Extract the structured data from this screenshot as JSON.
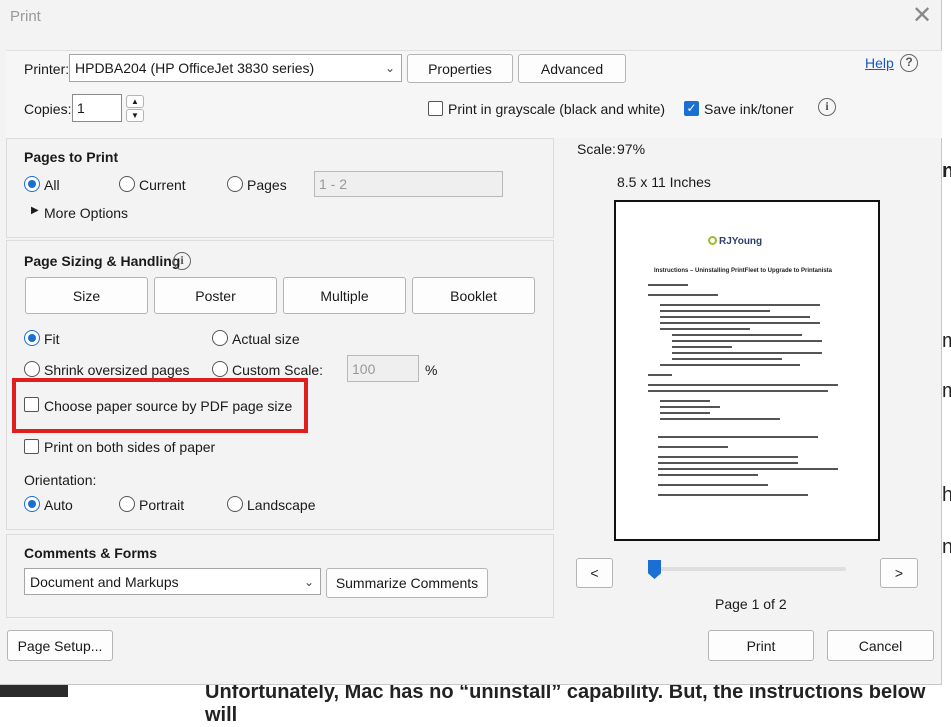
{
  "background": {
    "visible_lines": [
      "Unfortunately, Mac has no “uninstall” capability. But, the instructions below will"
    ],
    "side_fragments": [
      "n",
      "m",
      "m",
      "h",
      "n"
    ]
  },
  "dialog": {
    "title": "Print",
    "close_label": "✕"
  },
  "printer": {
    "label": "Printer:",
    "selected": "HPDBA204 (HP OfficeJet 3830 series)",
    "properties_button": "Properties",
    "advanced_button": "Advanced",
    "help_link": "Help",
    "help_icon": "?"
  },
  "copies": {
    "label": "Copies:",
    "value": "1",
    "up": "▲",
    "down": "▼"
  },
  "options": {
    "grayscale_label": "Print in grayscale (black and white)",
    "grayscale_checked": false,
    "save_ink_label": "Save ink/toner",
    "save_ink_checked": true,
    "info_icon": "i"
  },
  "pages_to_print": {
    "title": "Pages to Print",
    "all": "All",
    "current": "Current",
    "pages": "Pages",
    "pages_range": "1 - 2",
    "more_options": "More Options",
    "selected": "all"
  },
  "sizing": {
    "title": "Page Sizing & Handling",
    "info_icon": "i",
    "tabs": [
      "Size",
      "Poster",
      "Multiple",
      "Booklet"
    ],
    "fit": "Fit",
    "actual_size": "Actual size",
    "shrink": "Shrink oversized pages",
    "custom_scale": "Custom Scale:",
    "custom_scale_value": "100",
    "percent": "%",
    "choose_paper_source": "Choose paper source by PDF page size",
    "both_sides": "Print on both sides of paper",
    "orientation_label": "Orientation:",
    "orientation_auto": "Auto",
    "orientation_portrait": "Portrait",
    "orientation_landscape": "Landscape"
  },
  "comments": {
    "title": "Comments & Forms",
    "selected": "Document and Markups",
    "summarize_button": "Summarize Comments"
  },
  "preview": {
    "scale_label": "Scale:",
    "scale_value": "97%",
    "paper_size": "8.5 x 11 Inches",
    "prev": "<",
    "next": ">",
    "page_indicator": "Page 1 of 2",
    "slider_position": 0,
    "doc_logo": "RJYoung",
    "doc_title": "Instructions – Uninstalling PrintFleet to Upgrade to Printanista"
  },
  "footer": {
    "page_setup": "Page Setup...",
    "print": "Print",
    "cancel": "Cancel"
  },
  "colors": {
    "accent": "#1b6ed2",
    "highlight_box": "#e01e1e",
    "link": "#1a56c4"
  }
}
